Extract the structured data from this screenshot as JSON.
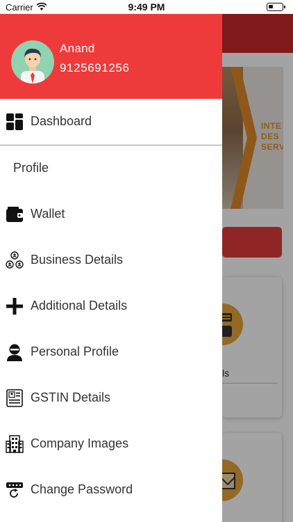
{
  "status_bar": {
    "carrier": "Carrier",
    "time": "9:49 PM",
    "wifi_icon": "wifi-icon",
    "battery_icon": "battery-icon"
  },
  "drawer": {
    "header_color": "#ef3a3b",
    "user": {
      "name": "Anand",
      "phone": "9125691256",
      "avatar_icon": "user-avatar-icon"
    },
    "items": [
      {
        "label": "Dashboard",
        "icon": "dashboard-grid-icon"
      },
      {
        "label": "Profile",
        "icon": ""
      },
      {
        "label": "Wallet",
        "icon": "wallet-icon"
      },
      {
        "label": "Business Details",
        "icon": "business-network-icon"
      },
      {
        "label": "Additional Details",
        "icon": "plus-icon"
      },
      {
        "label": "Personal Profile",
        "icon": "person-icon"
      },
      {
        "label": "GSTIN Details",
        "icon": "gstin-document-icon"
      },
      {
        "label": "Company Images",
        "icon": "building-icon"
      },
      {
        "label": "Change Password",
        "icon": "password-reset-icon"
      }
    ]
  },
  "background_app": {
    "brand_color": "#c82a29",
    "accent_color": "#e0922c",
    "banner_text": [
      "INTE",
      "DES",
      "SERV"
    ],
    "card_caption": "ls"
  }
}
